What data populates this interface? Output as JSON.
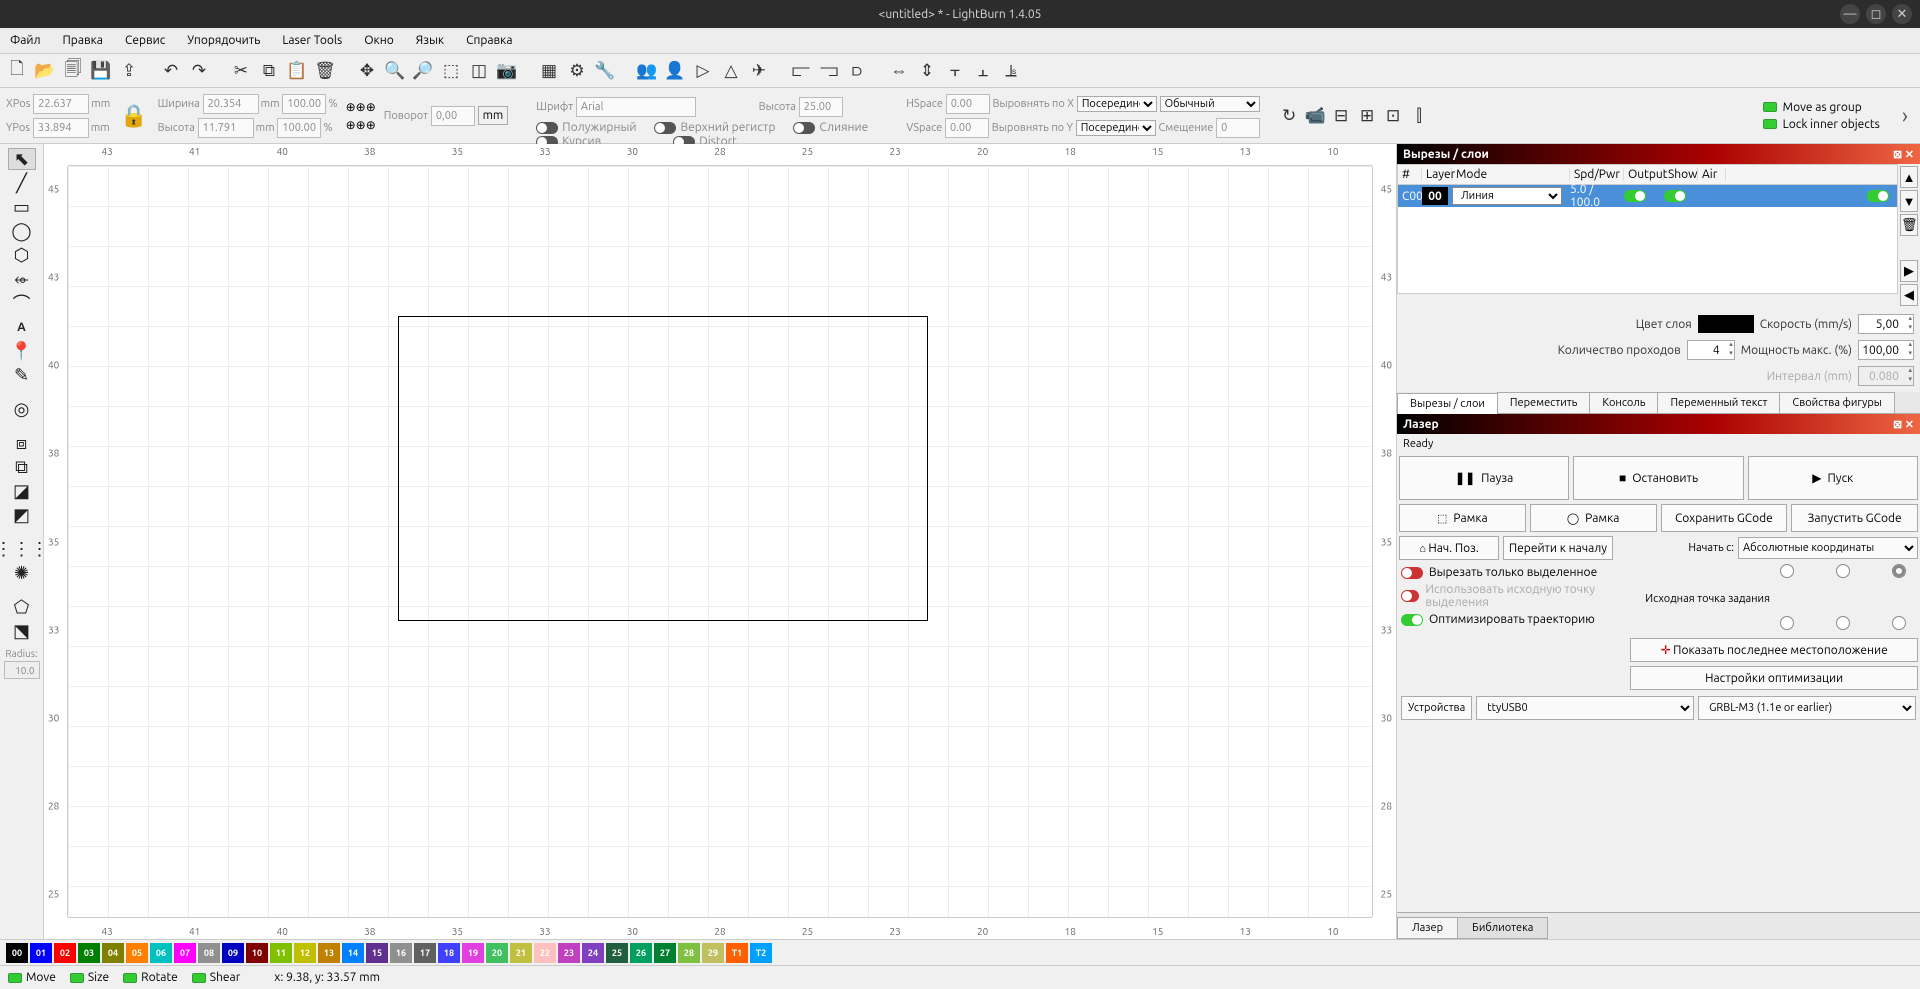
{
  "title": "<untitled> * - LightBurn 1.4.05",
  "menu": [
    "Файл",
    "Правка",
    "Сервис",
    "Упорядочить",
    "Laser Tools",
    "Окно",
    "Язык",
    "Справка"
  ],
  "propbar": {
    "xpos_label": "XPos",
    "xpos": "22.637",
    "ypos_label": "YPos",
    "ypos": "33.894",
    "width_label": "Ширина",
    "width": "20.354",
    "height_label": "Высота",
    "height": "11.791",
    "pct1": "100.000",
    "pct2": "100.000",
    "rotate_label": "Поворот",
    "rotate": "0,00",
    "mm": "mm",
    "unit_mm": "mm",
    "unit_pct": "%",
    "font_label": "Шрифт",
    "font": "Arial",
    "font_height_label": "Высота",
    "font_height": "25.00",
    "bold": "Полужирный",
    "upper": "Верхний регистр",
    "merge": "Слияние",
    "italic": "Курсив",
    "distort": "Distort",
    "hspace_label": "HSpace",
    "hspace": "0.00",
    "vspace_label": "VSpace",
    "vspace": "0.00",
    "alignx_label": "Выровнять по X",
    "alignx": "Посередине",
    "aligny_label": "Выровнять по Y",
    "aligny": "Посередине",
    "normal": "Обычный",
    "offset_label": "Смещение",
    "offset": "0",
    "move_group": "Move as group",
    "lock_inner": "Lock inner objects"
  },
  "ruler_h": [
    "43",
    "41",
    "40",
    "38",
    "35",
    "33",
    "30",
    "28",
    "25",
    "23",
    "20",
    "18",
    "15",
    "13",
    "10"
  ],
  "ruler_v": [
    "45",
    "43",
    "40",
    "38",
    "35",
    "33",
    "30",
    "28",
    "25"
  ],
  "left_tools_radius_label": "Radius:",
  "left_tools_radius": "10.0",
  "panels": {
    "cuts_title": "Вырезы / слои",
    "cuts_headers": {
      "num": "#",
      "layer": "Layer",
      "mode": "Mode",
      "spdpwr": "Spd/Pwr",
      "output": "Output",
      "show": "Show",
      "air": "Air"
    },
    "row": {
      "code": "C00",
      "layer": "00",
      "mode": "Линия",
      "spdpwr": "5.0 / 100.0"
    },
    "layer_color_label": "Цвет слоя",
    "speed_label": "Скорость (mm/s)",
    "speed": "5,00",
    "passes_label": "Количество проходов",
    "passes": "4",
    "power_label": "Мощность макс. (%)",
    "power": "100,00",
    "interval_label": "Интервал (mm)",
    "interval": "0.080",
    "tabs": [
      "Вырезы / слои",
      "Переместить",
      "Консоль",
      "Переменный текст",
      "Свойства фигуры"
    ]
  },
  "laser": {
    "title": "Лазер",
    "status": "Ready",
    "pause": "Пауза",
    "stop": "Остановить",
    "start": "Пуск",
    "frame": "Рамка",
    "frame2": "Рамка",
    "save_gcode": "Сохранить GCode",
    "run_gcode": "Запустить GCode",
    "home": "Нач. Поз.",
    "goto_origin": "Перейти к началу",
    "start_from_label": "Начать с:",
    "start_from": "Абсолютные координаты",
    "job_origin_label": "Исходная точка задания",
    "cut_sel": "Вырезать только выделенное",
    "use_sel_origin": "Использовать исходную точку выделения",
    "optimize": "Оптимизировать траекторию",
    "show_last": "Показать последнее местоположение",
    "opt_settings": "Настройки оптимизации",
    "devices": "Устройства",
    "port": "ttyUSB0",
    "firmware": "GRBL-M3 (1.1e or earlier)",
    "tabs": [
      "Лазер",
      "Библиотека"
    ]
  },
  "palette": [
    {
      "t": "00",
      "c": "#000000"
    },
    {
      "t": "01",
      "c": "#0000ff"
    },
    {
      "t": "02",
      "c": "#ff0000"
    },
    {
      "t": "03",
      "c": "#008000"
    },
    {
      "t": "04",
      "c": "#808000"
    },
    {
      "t": "05",
      "c": "#ff8000"
    },
    {
      "t": "06",
      "c": "#00c0c0"
    },
    {
      "t": "07",
      "c": "#ff00ff"
    },
    {
      "t": "08",
      "c": "#909090"
    },
    {
      "t": "09",
      "c": "#0000c0"
    },
    {
      "t": "10",
      "c": "#800000"
    },
    {
      "t": "11",
      "c": "#80c000"
    },
    {
      "t": "12",
      "c": "#c0c000"
    },
    {
      "t": "13",
      "c": "#c08000"
    },
    {
      "t": "14",
      "c": "#0080ff"
    },
    {
      "t": "15",
      "c": "#603090"
    },
    {
      "t": "16",
      "c": "#909090"
    },
    {
      "t": "17",
      "c": "#606060"
    },
    {
      "t": "18",
      "c": "#4040ff"
    },
    {
      "t": "19",
      "c": "#e040e0"
    },
    {
      "t": "20",
      "c": "#40c060"
    },
    {
      "t": "21",
      "c": "#c0c040"
    },
    {
      "t": "22",
      "c": "#ffc0c0"
    },
    {
      "t": "23",
      "c": "#c040c0"
    },
    {
      "t": "24",
      "c": "#8040c0"
    },
    {
      "t": "25",
      "c": "#206040"
    },
    {
      "t": "26",
      "c": "#00a060"
    },
    {
      "t": "27",
      "c": "#008030"
    },
    {
      "t": "28",
      "c": "#80c040"
    },
    {
      "t": "29",
      "c": "#c0c060"
    },
    {
      "t": "T1",
      "c": "#ff6000"
    },
    {
      "t": "T2",
      "c": "#00a0ff"
    }
  ],
  "statusbar": {
    "move": "Move",
    "size": "Size",
    "rotate": "Rotate",
    "shear": "Shear",
    "coord": "x: 9.38, y: 33.57 mm"
  }
}
